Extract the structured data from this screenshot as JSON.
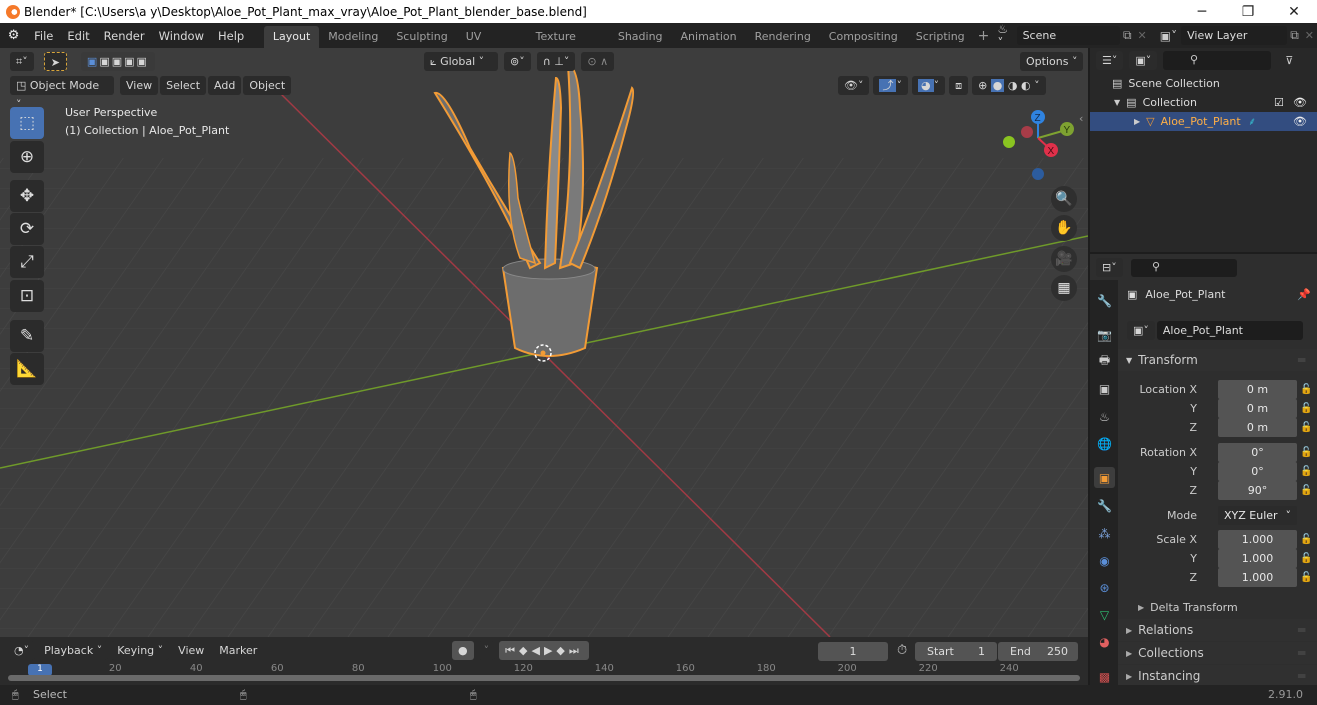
{
  "window": {
    "title": "Blender* [C:\\Users\\a y\\Desktop\\Aloe_Pot_Plant_max_vray\\Aloe_Pot_Plant_blender_base.blend]",
    "minimize": "─",
    "maximize": "❐",
    "close": "✕"
  },
  "menu": [
    "File",
    "Edit",
    "Render",
    "Window",
    "Help"
  ],
  "workspaces": [
    {
      "label": "Layout",
      "active": true
    },
    {
      "label": "Modeling"
    },
    {
      "label": "Sculpting"
    },
    {
      "label": "UV Editing"
    },
    {
      "label": "Texture Paint"
    },
    {
      "label": "Shading"
    },
    {
      "label": "Animation"
    },
    {
      "label": "Rendering"
    },
    {
      "label": "Compositing"
    },
    {
      "label": "Scripting"
    }
  ],
  "add_workspace": "+",
  "scene": {
    "value": "Scene"
  },
  "view_layer": {
    "value": "View Layer"
  },
  "viewport": {
    "mode": "Object Mode",
    "header_menus": [
      "View",
      "Select",
      "Add",
      "Object"
    ],
    "transform_orientation": "Global",
    "options": "Options",
    "overlay_title": "User Perspective",
    "overlay_subtitle": "(1) Collection | Aloe_Pot_Plant",
    "gizmo": {
      "x": "X",
      "y": "Y",
      "z": "Z"
    },
    "colors": {
      "x_axis": "#a13a44",
      "y_axis": "#6f9a2a",
      "selection": "#f29b36",
      "active_tool": "#4772b3"
    }
  },
  "outliner": {
    "search_placeholder": "",
    "items": [
      {
        "label": "Scene Collection",
        "type": "scene-collection"
      },
      {
        "label": "Collection",
        "type": "collection",
        "checked": true,
        "visible": true
      },
      {
        "label": "Aloe_Pot_Plant",
        "type": "object",
        "selected": true,
        "visible": true
      }
    ]
  },
  "properties": {
    "search_placeholder": "",
    "object_name": "Aloe_Pot_Plant",
    "object_datablock": "Aloe_Pot_Plant",
    "transform_header": "Transform",
    "location": {
      "label": "Location X",
      "x": "0 m",
      "y": "0 m",
      "z": "0 m"
    },
    "rotation": {
      "label": "Rotation X",
      "x": "0°",
      "y": "0°",
      "z": "90°"
    },
    "mode": {
      "label": "Mode",
      "value": "XYZ Euler"
    },
    "scale": {
      "label": "Scale X",
      "x": "1.000",
      "y": "1.000",
      "z": "1.000"
    },
    "axis_labels": {
      "y": "Y",
      "z": "Z"
    },
    "subpanels": [
      "Delta Transform"
    ],
    "panels": [
      "Relations",
      "Collections",
      "Instancing"
    ]
  },
  "timeline": {
    "menus": [
      "Playback",
      "Keying",
      "View",
      "Marker"
    ],
    "current_frame": "1",
    "start_label": "Start",
    "start": "1",
    "end_label": "End",
    "end": "250",
    "ticks": [
      "20",
      "40",
      "60",
      "80",
      "100",
      "120",
      "140",
      "160",
      "180",
      "200",
      "220",
      "240"
    ],
    "playhead": "1"
  },
  "statusbar": {
    "left": "Select",
    "version": "2.91.0"
  }
}
